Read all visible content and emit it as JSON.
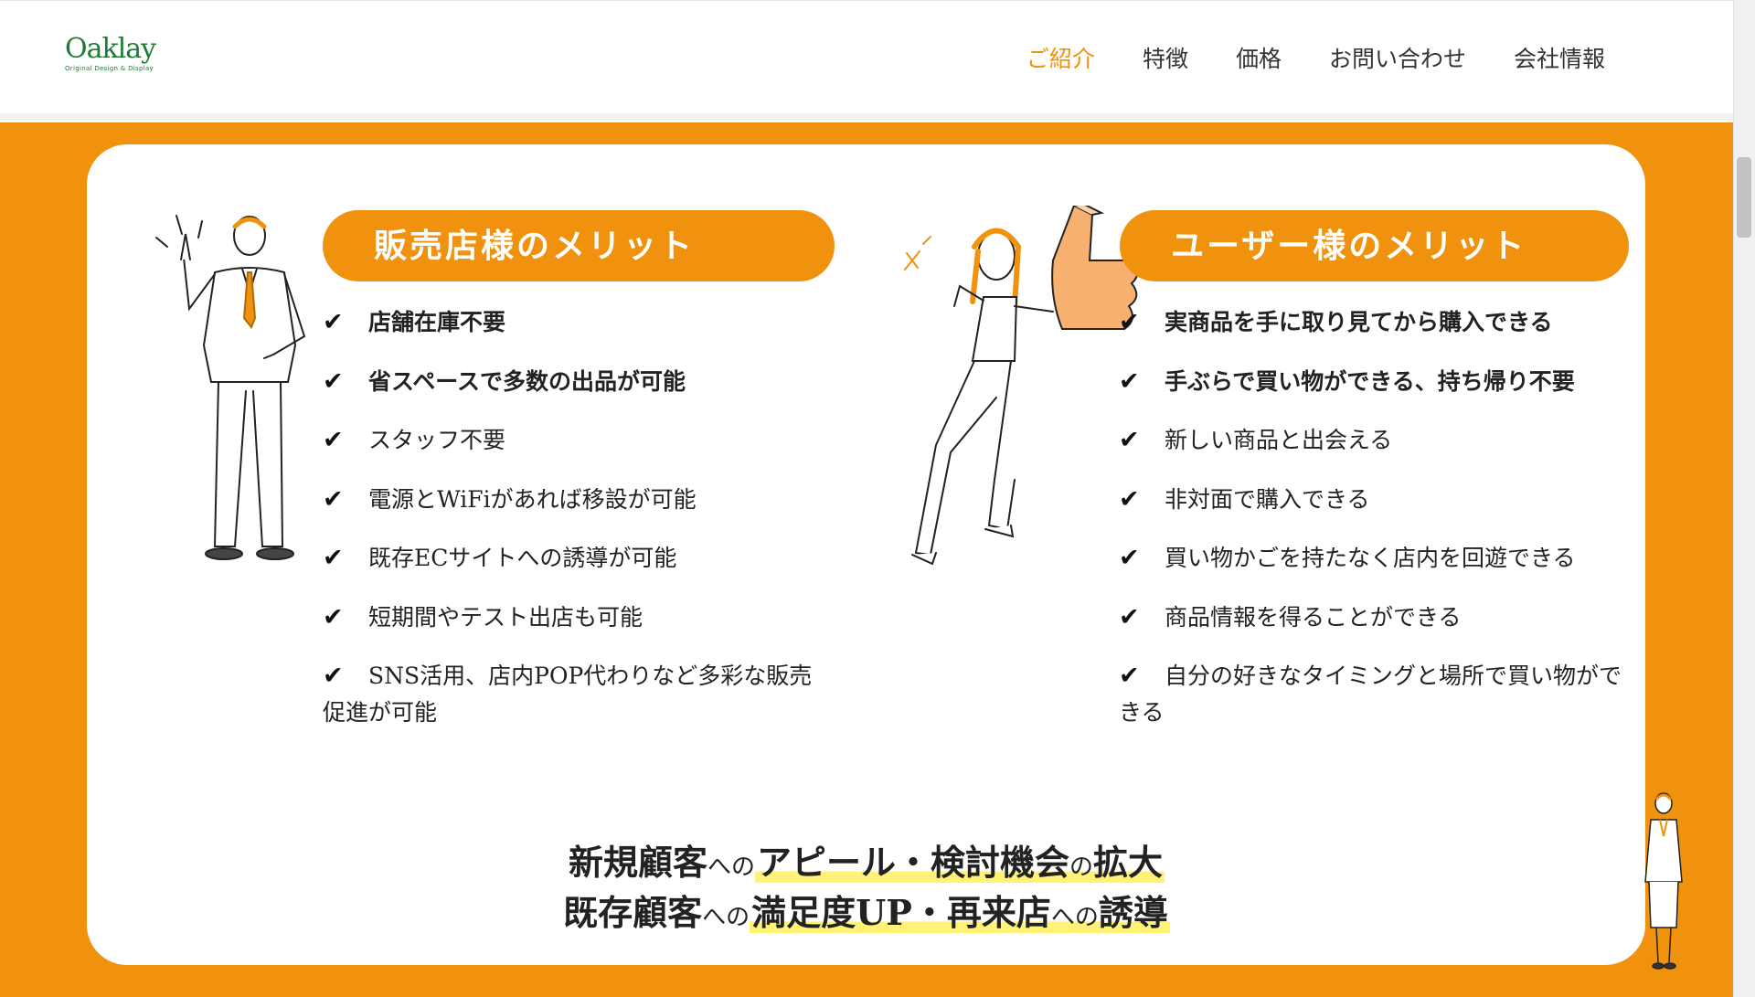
{
  "colors": {
    "accent": "#f0920e",
    "brand_green": "#1f7a36",
    "highlight": "#fff275",
    "text": "#222222"
  },
  "header": {
    "logo_word": "Oaklay",
    "logo_tagline": "Original Design & Display",
    "nav": [
      {
        "label": "ご紹介",
        "active": true
      },
      {
        "label": "特徴"
      },
      {
        "label": "価格"
      },
      {
        "label": "お問い合わせ"
      },
      {
        "label": "会社情報"
      }
    ]
  },
  "left": {
    "title": "販売店様のメリット",
    "items": [
      {
        "check": "✔",
        "text": "店舗在庫不要",
        "bold": true
      },
      {
        "check": "✔",
        "text": "省スペースで多数の出品が可能",
        "bold": true
      },
      {
        "check": "✔",
        "text": "スタッフ不要"
      },
      {
        "check": "✔",
        "text": "電源とWiFiがあれば移設が可能"
      },
      {
        "check": "✔",
        "text": "既存ECサイトへの誘導が可能"
      },
      {
        "check": "✔",
        "text": "短期間やテスト出店も可能"
      },
      {
        "check": "✔",
        "text": "SNS活用、店内POP代わりなど多彩な販売促進が可能"
      }
    ]
  },
  "right": {
    "title": "ユーザー様のメリット",
    "items": [
      {
        "check": "✔",
        "text": "実商品を手に取り見てから購入できる",
        "bold": true
      },
      {
        "check": "✔",
        "text": "手ぶらで買い物ができる、持ち帰り不要",
        "bold": true
      },
      {
        "check": "✔",
        "text": "新しい商品と出会える"
      },
      {
        "check": "✔",
        "text": "非対面で購入できる"
      },
      {
        "check": "✔",
        "text": "買い物かごを持たなく店内を回遊できる"
      },
      {
        "check": "✔",
        "text": "商品情報を得ることができる"
      },
      {
        "check": "✔",
        "text": "自分の好きなタイミングと場所で買い物ができる"
      }
    ]
  },
  "summary": {
    "line1": {
      "a": "新規顧客",
      "b": "への",
      "c": "アピール・検討機会",
      "d": "の",
      "e": "拡大"
    },
    "line2": {
      "a": "既存顧客",
      "b": "への",
      "c": "満足度UP・再来店",
      "d": "への",
      "e": "誘導"
    }
  }
}
